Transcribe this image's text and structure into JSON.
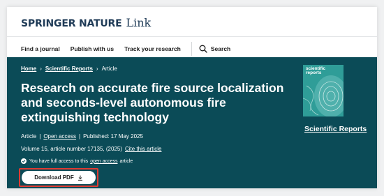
{
  "brand": {
    "name": "SPRINGER NATURE",
    "suffix": "Link"
  },
  "nav": {
    "items": [
      "Find a journal",
      "Publish with us",
      "Track your research"
    ],
    "search_label": "Search"
  },
  "breadcrumb": {
    "home": "Home",
    "journal": "Scientific Reports",
    "current": "Article"
  },
  "article": {
    "title": "Research on accurate fire source localization and seconds-level autonomous fire extinguishing technology",
    "type": "Article",
    "open_access": "Open access",
    "published": "Published: 17 May 2025",
    "volume_info": "Volume 15, article number 17135, (2025)",
    "cite": "Cite this article"
  },
  "access": {
    "prefix": "You have full access to this",
    "link": "open access",
    "suffix": "article"
  },
  "download": {
    "label": "Download PDF"
  },
  "journal": {
    "cover_title": "scientific reports",
    "name": "Scientific Reports"
  },
  "colors": {
    "hero_bg": "#0b4b57",
    "brand": "#1f3b57",
    "highlight": "#e03b32",
    "cover": "#3aa9a3"
  }
}
